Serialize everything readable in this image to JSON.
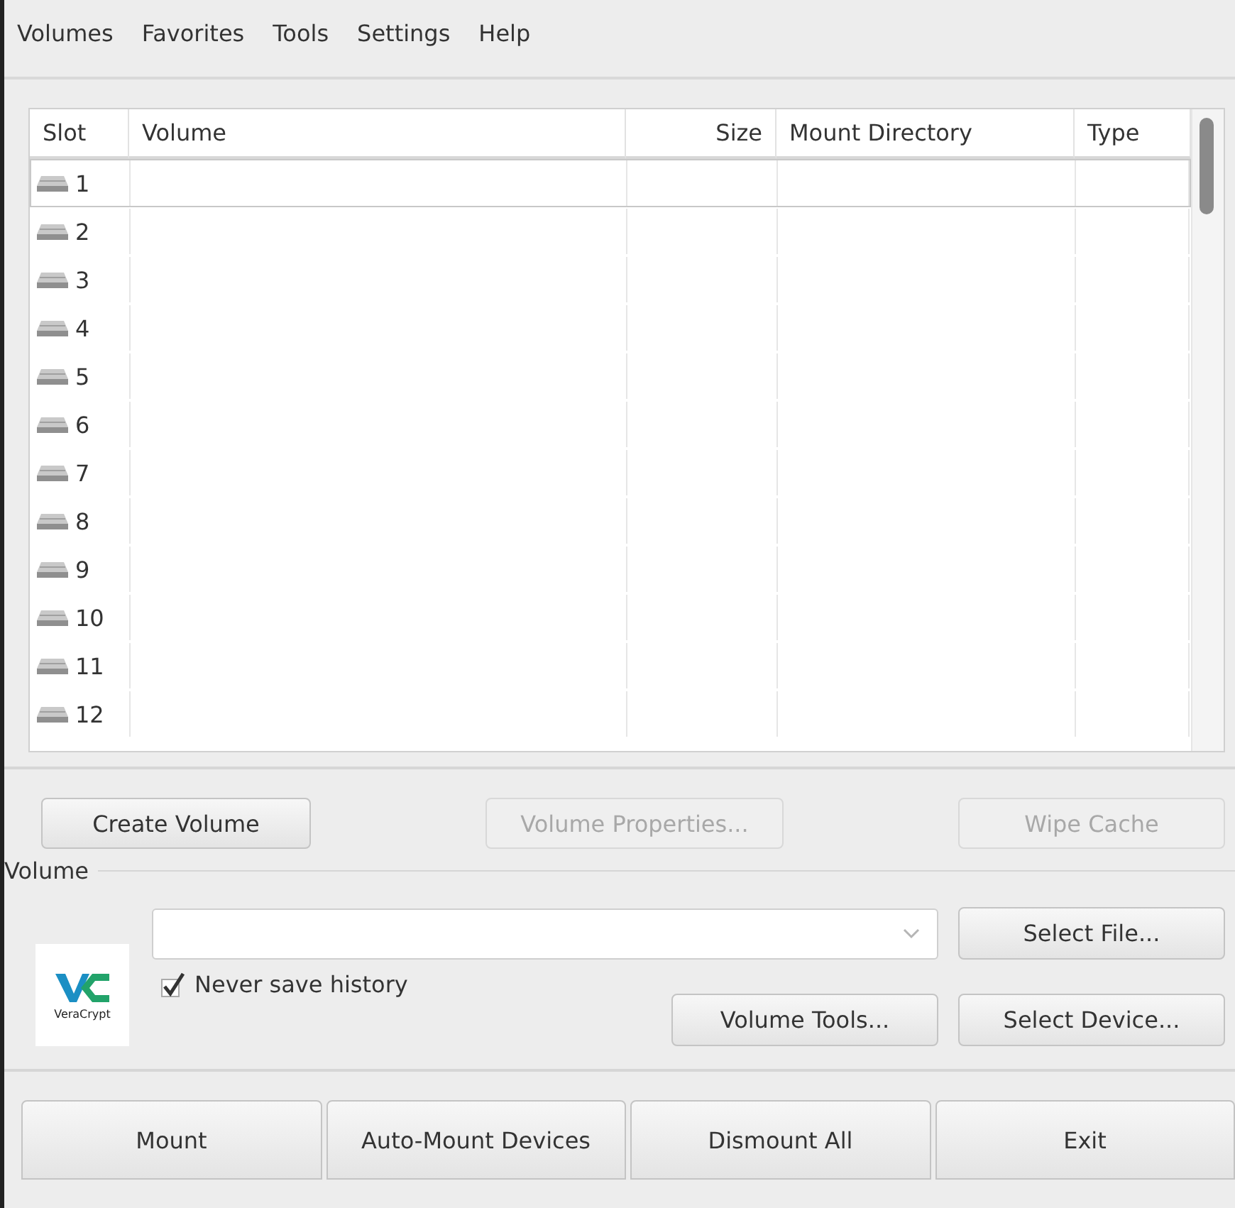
{
  "menu": [
    {
      "label": "Volumes"
    },
    {
      "label": "Favorites"
    },
    {
      "label": "Tools"
    },
    {
      "label": "Settings"
    },
    {
      "label": "Help"
    }
  ],
  "table": {
    "columns": [
      {
        "label": "Slot"
      },
      {
        "label": "Volume"
      },
      {
        "label": "Size"
      },
      {
        "label": "Mount Directory"
      },
      {
        "label": "Type"
      }
    ],
    "rows": [
      {
        "slot": "1",
        "selected": true
      },
      {
        "slot": "2",
        "selected": false
      },
      {
        "slot": "3",
        "selected": false
      },
      {
        "slot": "4",
        "selected": false
      },
      {
        "slot": "5",
        "selected": false
      },
      {
        "slot": "6",
        "selected": false
      },
      {
        "slot": "7",
        "selected": false
      },
      {
        "slot": "8",
        "selected": false
      },
      {
        "slot": "9",
        "selected": false
      },
      {
        "slot": "10",
        "selected": false
      },
      {
        "slot": "11",
        "selected": false
      },
      {
        "slot": "12",
        "selected": false
      }
    ]
  },
  "actions": [
    {
      "label": "Create Volume",
      "disabled": false
    },
    {
      "label": "Volume Properties...",
      "disabled": true
    },
    {
      "label": "Wipe Cache",
      "disabled": true
    }
  ],
  "volume_group": {
    "label": "Volume",
    "logo_text": "VeraCrypt",
    "never_save_history": {
      "label": "Never save history",
      "checked": true
    },
    "buttons": [
      {
        "label": "Select File...",
        "disabled": false
      },
      {
        "label": "Volume Tools...",
        "disabled": false
      },
      {
        "label": "Select Device...",
        "disabled": false
      }
    ]
  },
  "bottom_buttons": [
    {
      "label": "Mount"
    },
    {
      "label": "Auto-Mount Devices"
    },
    {
      "label": "Dismount All"
    },
    {
      "label": "Exit"
    }
  ]
}
